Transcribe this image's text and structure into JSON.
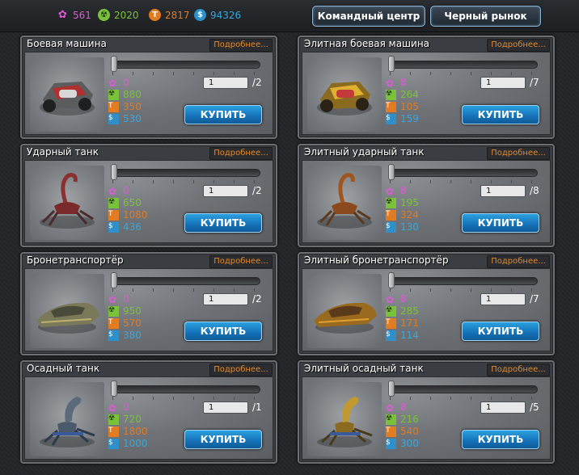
{
  "resources": [
    {
      "icon": "crystal-icon",
      "value": "561",
      "color": "#e05ad8"
    },
    {
      "icon": "uranium-icon",
      "value": "2020",
      "color": "#7ac23a"
    },
    {
      "icon": "titan-icon",
      "value": "2817",
      "color": "#e17c22"
    },
    {
      "icon": "credits-icon",
      "value": "94326",
      "color": "#38a8dc"
    }
  ],
  "nav": {
    "command_center": "Командный центр",
    "black_market": "Черный рынок"
  },
  "more_label": "Подробнее...",
  "buy_label": "КУПИТЬ",
  "cards": [
    {
      "title": "Боевая машина",
      "crystal": "0",
      "uranium": "880",
      "titan": "350",
      "credits": "530",
      "qty": "1",
      "max": "/2",
      "icon": "combat-vehicle-icon"
    },
    {
      "title": "Элитная боевая машина",
      "crystal": "8",
      "uranium": "264",
      "titan": "105",
      "credits": "159",
      "qty": "1",
      "max": "/7",
      "icon": "elite-combat-vehicle-icon"
    },
    {
      "title": "Ударный танк",
      "crystal": "0",
      "uranium": "650",
      "titan": "1080",
      "credits": "436",
      "qty": "1",
      "max": "/2",
      "icon": "assault-tank-icon"
    },
    {
      "title": "Элитный ударный танк",
      "crystal": "8",
      "uranium": "195",
      "titan": "324",
      "credits": "130",
      "qty": "1",
      "max": "/8",
      "icon": "elite-assault-tank-icon"
    },
    {
      "title": "Бронетранспортёр",
      "crystal": "0",
      "uranium": "950",
      "titan": "570",
      "credits": "380",
      "qty": "1",
      "max": "/2",
      "icon": "armored-carrier-icon"
    },
    {
      "title": "Элитный бронетранспортёр",
      "crystal": "8",
      "uranium": "285",
      "titan": "171",
      "credits": "114",
      "qty": "1",
      "max": "/7",
      "icon": "elite-armored-carrier-icon"
    },
    {
      "title": "Осадный танк",
      "crystal": "0",
      "uranium": "720",
      "titan": "1800",
      "credits": "1000",
      "qty": "1",
      "max": "/1",
      "icon": "siege-tank-icon"
    },
    {
      "title": "Элитный осадный танк",
      "crystal": "8",
      "uranium": "216",
      "titan": "540",
      "credits": "300",
      "qty": "1",
      "max": "/5",
      "icon": "elite-siege-tank-icon"
    }
  ]
}
